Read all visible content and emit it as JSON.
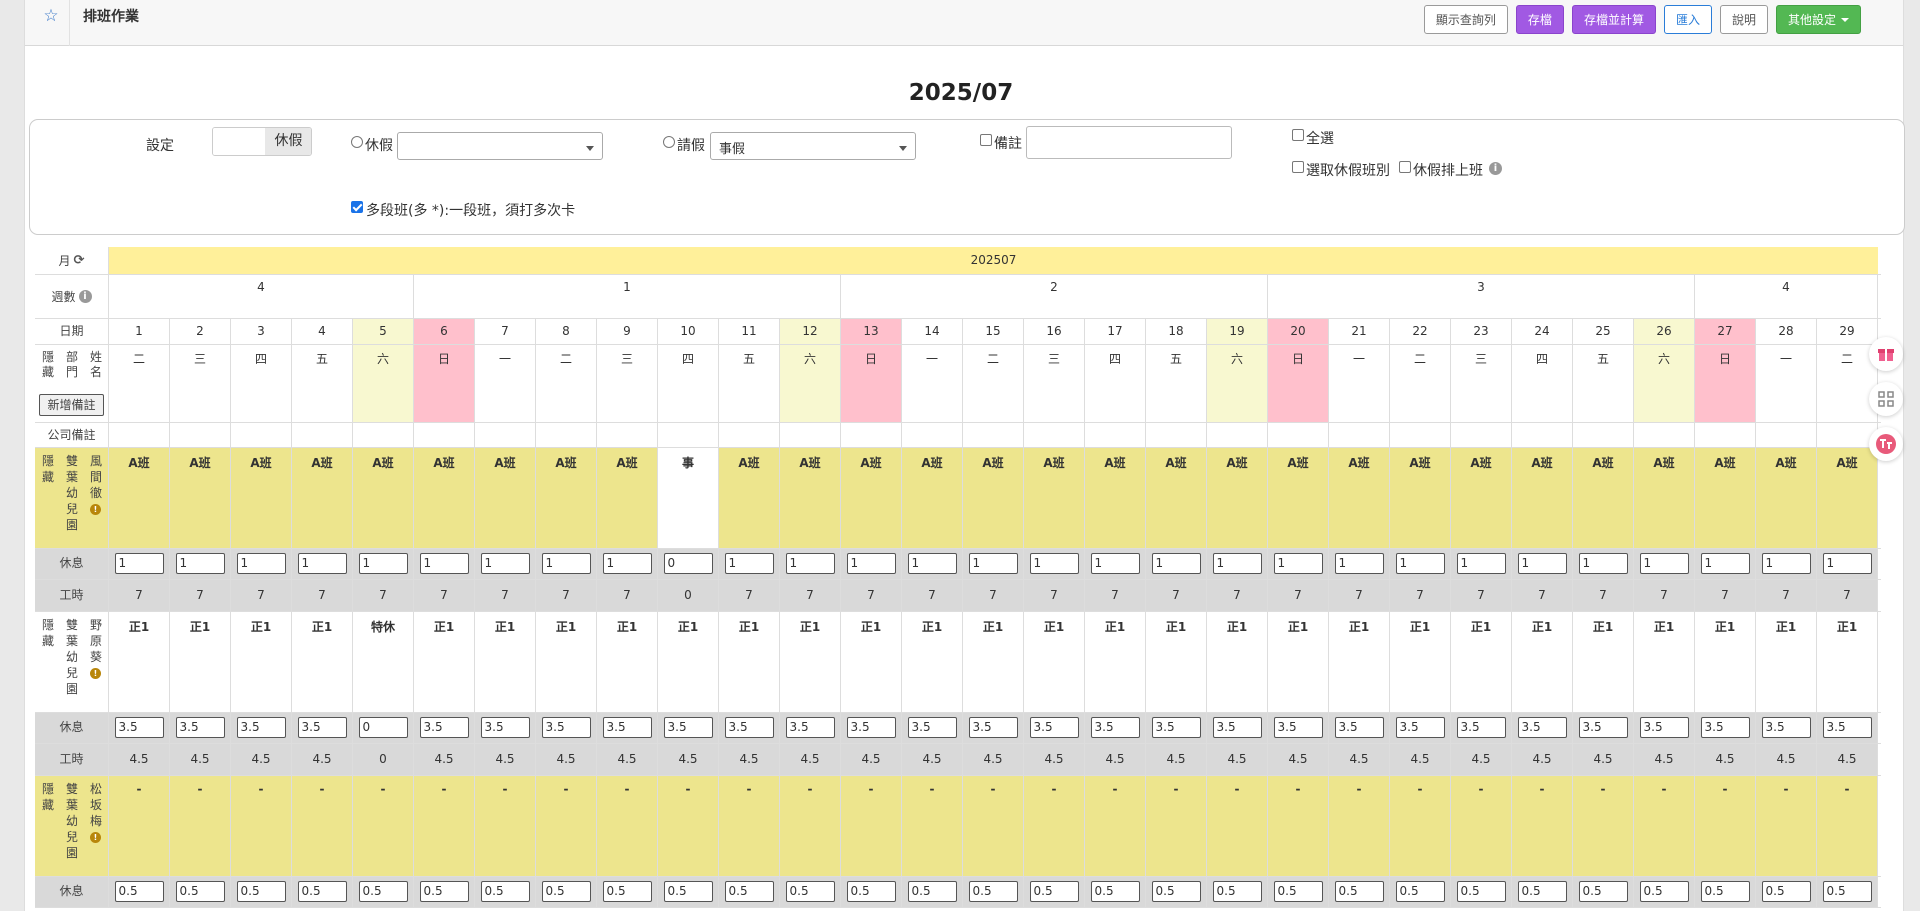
{
  "header": {
    "title": "排班作業",
    "buttons": {
      "show_query": "顯示查詢列",
      "save": "存檔",
      "save_calc": "存檔並計算",
      "import": "匯入",
      "help": "說明",
      "other": "其他設定"
    }
  },
  "month_title": "2025/07",
  "settings": {
    "set_label": "設定",
    "set_value": "休假",
    "leave_label": "休假",
    "leave_select": "",
    "request_label": "請假",
    "request_select": "事假",
    "note_label": "備註",
    "note_value": "",
    "select_all": "全選",
    "select_leave_shift": "選取休假班別",
    "leave_on_shift": "休假排上班",
    "multi_shift": "多段班(多 *):一段班，須打多次卡",
    "multi_shift_checked": true
  },
  "table": {
    "month_label": "月",
    "month_value": "202507",
    "week_label": "週數",
    "weeks": [
      {
        "label": "4",
        "span": 5
      },
      {
        "label": "1",
        "span": 7
      },
      {
        "label": "2",
        "span": 7
      },
      {
        "label": "3",
        "span": 7
      },
      {
        "label": "4",
        "span": 3
      }
    ],
    "date_label": "日期",
    "col_hide": "隱藏",
    "col_dept": "部門",
    "col_name": "姓名",
    "add_note": "新增備註",
    "company_note": "公司備註",
    "dates": [
      "1",
      "2",
      "3",
      "4",
      "5",
      "6",
      "7",
      "8",
      "9",
      "10",
      "11",
      "12",
      "13",
      "14",
      "15",
      "16",
      "17",
      "18",
      "19",
      "20",
      "21",
      "22",
      "23",
      "24",
      "25",
      "26",
      "27",
      "28",
      "29"
    ],
    "weekdays": [
      "二",
      "三",
      "四",
      "五",
      "六",
      "日",
      "一",
      "二",
      "三",
      "四",
      "五",
      "六",
      "日",
      "一",
      "二",
      "三",
      "四",
      "五",
      "六",
      "日",
      "一",
      "二",
      "三",
      "四",
      "五",
      "六",
      "日",
      "一",
      "二"
    ],
    "day_types": [
      "w",
      "w",
      "w",
      "w",
      "sat",
      "sun",
      "w",
      "w",
      "w",
      "w",
      "w",
      "sat",
      "sun",
      "w",
      "w",
      "w",
      "w",
      "w",
      "sat",
      "sun",
      "w",
      "w",
      "w",
      "w",
      "w",
      "sat",
      "sun",
      "w",
      "w"
    ],
    "rest_label": "休息",
    "hours_label": "工時",
    "employees": [
      {
        "hide": "隱藏",
        "dept": "雙葉幼兒園",
        "name": "風間徹",
        "bg": "khaki",
        "shifts": [
          "A班",
          "A班",
          "A班",
          "A班",
          "A班",
          "A班",
          "A班",
          "A班",
          "A班",
          "事",
          "A班",
          "A班",
          "A班",
          "A班",
          "A班",
          "A班",
          "A班",
          "A班",
          "A班",
          "A班",
          "A班",
          "A班",
          "A班",
          "A班",
          "A班",
          "A班",
          "A班",
          "A班",
          "A班"
        ],
        "rest": [
          "1",
          "1",
          "1",
          "1",
          "1",
          "1",
          "1",
          "1",
          "1",
          "0",
          "1",
          "1",
          "1",
          "1",
          "1",
          "1",
          "1",
          "1",
          "1",
          "1",
          "1",
          "1",
          "1",
          "1",
          "1",
          "1",
          "1",
          "1",
          "1"
        ],
        "hours": [
          "7",
          "7",
          "7",
          "7",
          "7",
          "7",
          "7",
          "7",
          "7",
          "0",
          "7",
          "7",
          "7",
          "7",
          "7",
          "7",
          "7",
          "7",
          "7",
          "7",
          "7",
          "7",
          "7",
          "7",
          "7",
          "7",
          "7",
          "7",
          "7"
        ]
      },
      {
        "hide": "隱藏",
        "dept": "雙葉幼兒園",
        "name": "野原葵",
        "bg": "white",
        "shifts": [
          "正1",
          "正1",
          "正1",
          "正1",
          "特休",
          "正1",
          "正1",
          "正1",
          "正1",
          "正1",
          "正1",
          "正1",
          "正1",
          "正1",
          "正1",
          "正1",
          "正1",
          "正1",
          "正1",
          "正1",
          "正1",
          "正1",
          "正1",
          "正1",
          "正1",
          "正1",
          "正1",
          "正1",
          "正1"
        ],
        "rest": [
          "3.5",
          "3.5",
          "3.5",
          "3.5",
          "0",
          "3.5",
          "3.5",
          "3.5",
          "3.5",
          "3.5",
          "3.5",
          "3.5",
          "3.5",
          "3.5",
          "3.5",
          "3.5",
          "3.5",
          "3.5",
          "3.5",
          "3.5",
          "3.5",
          "3.5",
          "3.5",
          "3.5",
          "3.5",
          "3.5",
          "3.5",
          "3.5",
          "3.5"
        ],
        "hours": [
          "4.5",
          "4.5",
          "4.5",
          "4.5",
          "0",
          "4.5",
          "4.5",
          "4.5",
          "4.5",
          "4.5",
          "4.5",
          "4.5",
          "4.5",
          "4.5",
          "4.5",
          "4.5",
          "4.5",
          "4.5",
          "4.5",
          "4.5",
          "4.5",
          "4.5",
          "4.5",
          "4.5",
          "4.5",
          "4.5",
          "4.5",
          "4.5",
          "4.5"
        ]
      },
      {
        "hide": "隱藏",
        "dept": "雙葉幼兒園",
        "name": "松坂梅",
        "bg": "khaki",
        "shifts": [
          "-",
          "-",
          "-",
          "-",
          "-",
          "-",
          "-",
          "-",
          "-",
          "-",
          "-",
          "-",
          "-",
          "-",
          "-",
          "-",
          "-",
          "-",
          "-",
          "-",
          "-",
          "-",
          "-",
          "-",
          "-",
          "-",
          "-",
          "-",
          "-"
        ],
        "rest": [
          "0.5",
          "0.5",
          "0.5",
          "0.5",
          "0.5",
          "0.5",
          "0.5",
          "0.5",
          "0.5",
          "0.5",
          "0.5",
          "0.5",
          "0.5",
          "0.5",
          "0.5",
          "0.5",
          "0.5",
          "0.5",
          "0.5",
          "0.5",
          "0.5",
          "0.5",
          "0.5",
          "0.5",
          "0.5",
          "0.5",
          "0.5",
          "0.5",
          "0.5"
        ],
        "hours": []
      }
    ]
  },
  "icons": {
    "star": "star-icon",
    "refresh": "refresh-icon",
    "info": "info-icon",
    "warning": "warning-icon",
    "gift": "gift-icon",
    "apps": "apps-icon",
    "translate": "translate-icon"
  },
  "colors": {
    "purple": "#a159e3",
    "green": "#53b853",
    "blue": "#2a7dd8",
    "month_yellow": "#fff09a",
    "saturday": "#f8f8d0",
    "sunday": "#ffc0cc",
    "khaki": "#ede58d"
  }
}
